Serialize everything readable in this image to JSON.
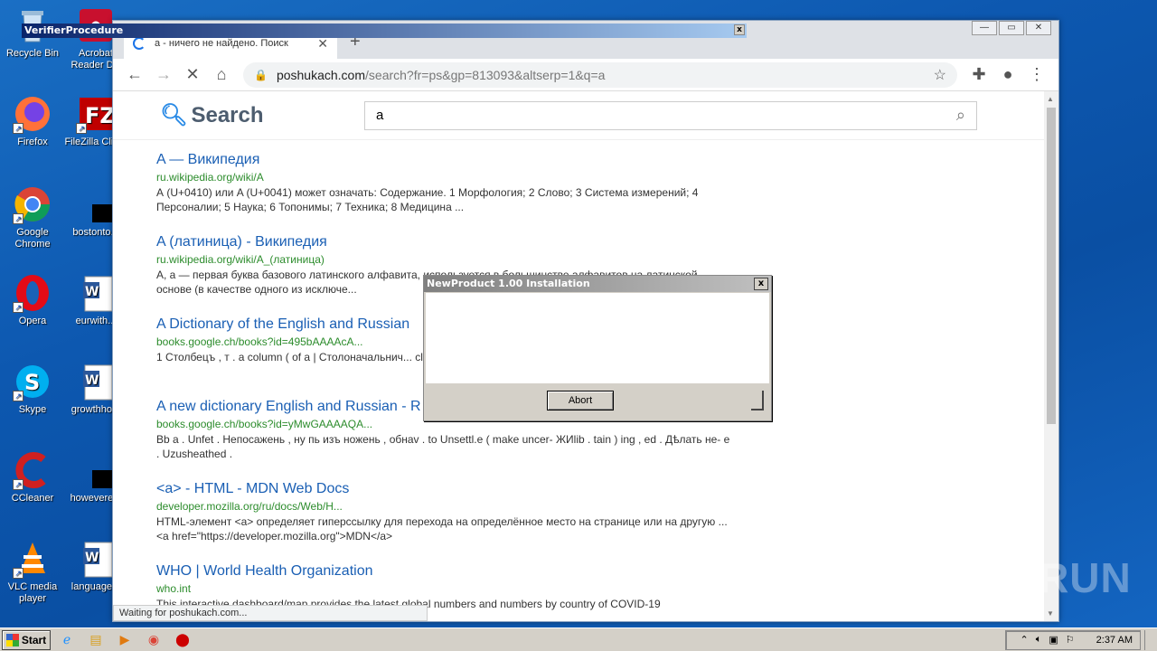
{
  "desktop": {
    "icons": [
      {
        "label": "Recycle Bin"
      },
      {
        "label": "Acrobat Reader DC"
      },
      {
        "label": "Firefox"
      },
      {
        "label": "FileZilla Client"
      },
      {
        "label": "Google Chrome"
      },
      {
        "label": "bostonto..."
      },
      {
        "label": "Opera"
      },
      {
        "label": "eurwith..."
      },
      {
        "label": "Skype"
      },
      {
        "label": "growthho..."
      },
      {
        "label": "CCleaner"
      },
      {
        "label": "howevere..."
      },
      {
        "label": "VLC media player"
      },
      {
        "label": "language..."
      }
    ]
  },
  "verifier": {
    "title": "VerifierProcedure",
    "close": "x"
  },
  "browser": {
    "tab_title": "а - ничего не найдено. Поиск",
    "tab_close": "✕",
    "new_tab": "+",
    "url_host": "poshukach.com",
    "url_path": "/search?fr=ps&gp=813093&altserp=1&q=a",
    "status": "Waiting for poshukach.com..."
  },
  "site": {
    "logo": "Search",
    "query": "a"
  },
  "results": [
    {
      "title": "A — Википедия",
      "url": "ru.wikipedia.org/wiki/A",
      "snippet": "А (U+0410) или A (U+0041) может означать: Содержание. 1 Морфология; 2 Слово; 3 Система измерений; 4 Персоналии; 5 Наука; 6 Топонимы; 7 Техника; 8 Медицина ..."
    },
    {
      "title": "A (латиница) - Википедия",
      "url": "ru.wikipedia.org/wiki/A_(латиница)",
      "snippet": "A, a — первая буква базового латинского алфавита, используется в большинстве алфавитов на латинской основе (в качестве одного из исключе..."
    },
    {
      "title": "A Dictionary of the English and Russian",
      "url": "books.google.ch/books?id=495bAAAAcA...",
      "snippet": "1 Столбецъ , т . a column ( of a | Столоначальнич... clerk . Столбикъ , d . s ."
    },
    {
      "title": "A new dictionary English and Russian - R",
      "url": "books.google.ch/books?id=yMwGAAAAQA...",
      "snippet": "Bb a . Unfet . Непосажень , ну пь изъ ножень , обнаv . to Unsettl.e ( make uncer- ЖИlib . tain ) ing , ed . Дѣлать не- е . Uzusheathed ."
    },
    {
      "title": "<a> - HTML - MDN Web Docs",
      "url": "developer.mozilla.org/ru/docs/Web/H...",
      "snippet": "HTML-элемент <a> определяет гиперссылку для перехода на определённое место на странице или на другую ... <a href=\"https://developer.mozilla.org\">MDN</a>"
    },
    {
      "title": "WHO | World Health Organization",
      "url": "who.int",
      "snippet": "This interactive dashboard/map provides the latest global numbers and numbers by country of COVID-19"
    }
  ],
  "dialog": {
    "title": "NewProduct 1.00 Installation",
    "close": "x",
    "abort": "Abort"
  },
  "watermark": "ANY RUN",
  "taskbar": {
    "start": "Start",
    "clock": "2:37 AM"
  }
}
